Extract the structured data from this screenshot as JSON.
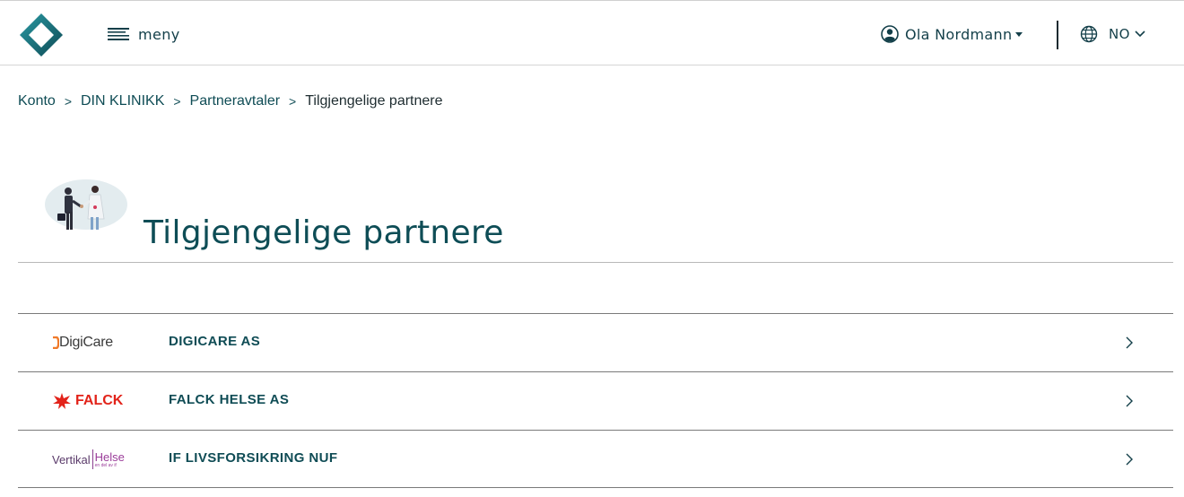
{
  "header": {
    "menu_label": "meny",
    "user_name": "Ola Nordmann",
    "language": "NO"
  },
  "breadcrumb": {
    "items": [
      {
        "label": "Konto"
      },
      {
        "label": "DIN KLINIKK"
      },
      {
        "label": "Partneravtaler"
      },
      {
        "label": "Tilgjengelige partnere"
      }
    ],
    "separator": ">"
  },
  "page": {
    "title": "Tilgjengelige partnere"
  },
  "partners": [
    {
      "name": "DIGICARE AS",
      "logo_text": "DigiCare",
      "logo_icon": "digicare-logo"
    },
    {
      "name": "FALCK HELSE AS",
      "logo_text": "FALCK",
      "logo_icon": "falck-logo"
    },
    {
      "name": "IF LIVSFORSIKRING NUF",
      "logo_text_a": "Vertikal",
      "logo_text_b": "Helse",
      "logo_sub": "en del av if",
      "logo_icon": "vertikal-helse-logo"
    }
  ],
  "colors": {
    "primary": "#0f4c55",
    "falck_red": "#e2231a",
    "vertikal_purple": "#9b3d9a",
    "logo_teal": "#1f7f8a"
  }
}
